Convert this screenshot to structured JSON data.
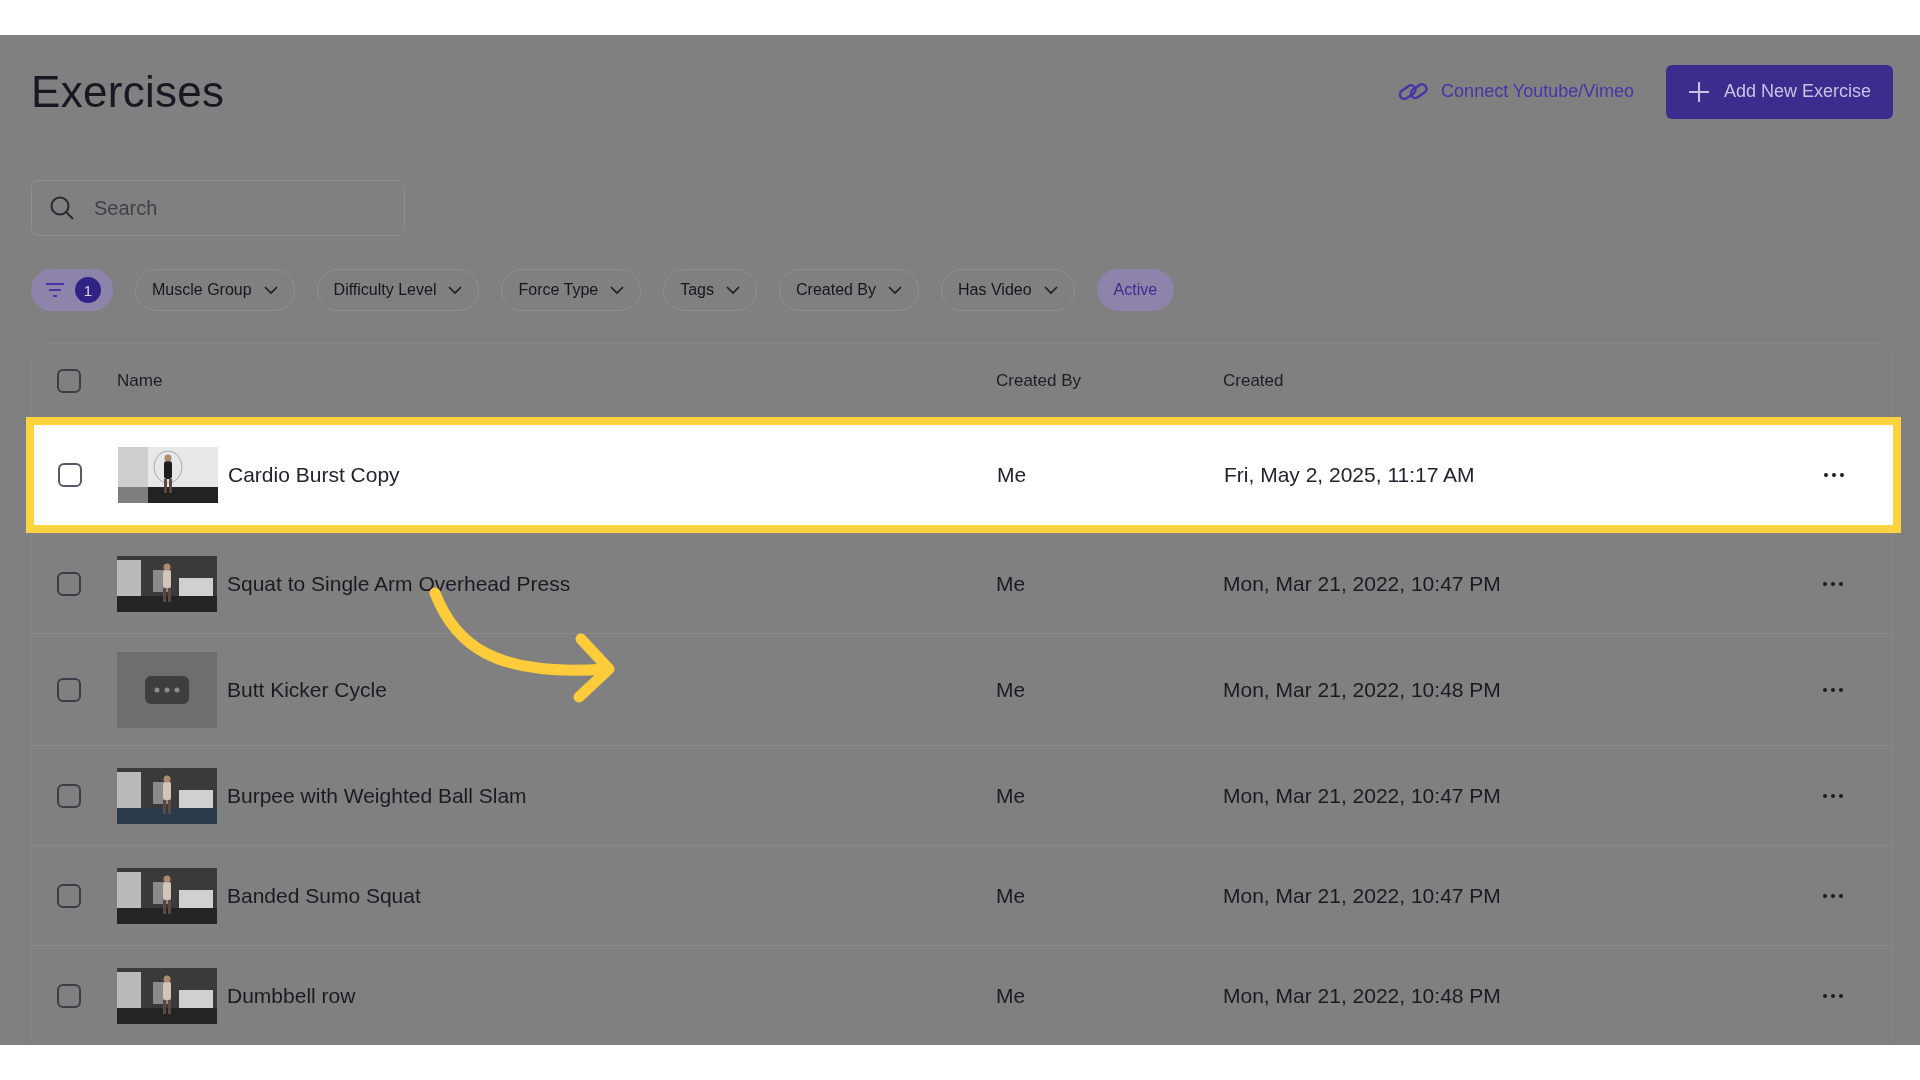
{
  "page": {
    "title": "Exercises"
  },
  "actions": {
    "link": "Connect Youtube/Vimeo",
    "button": "Add New Exercise"
  },
  "search": {
    "placeholder": "Search"
  },
  "filter_count": "1",
  "filters": [
    {
      "label": "Muscle Group",
      "kind": "dropdown",
      "selected": false
    },
    {
      "label": "Difficulty Level",
      "kind": "dropdown",
      "selected": false
    },
    {
      "label": "Force Type",
      "kind": "dropdown",
      "selected": false
    },
    {
      "label": "Tags",
      "kind": "dropdown",
      "selected": false
    },
    {
      "label": "Created By",
      "kind": "dropdown",
      "selected": false
    },
    {
      "label": "Has Video",
      "kind": "dropdown",
      "selected": false
    },
    {
      "label": "Active",
      "kind": "toggle",
      "selected": true
    }
  ],
  "table": {
    "columns": [
      "Name",
      "Created By",
      "Created"
    ],
    "select_all_checked": false,
    "rows": [
      {
        "name": "Cardio Burst Copy",
        "created_by": "Me",
        "created": "Fri, May 2, 2025, 11:17 AM",
        "checked": false,
        "highlighted": true,
        "kind": "picture"
      },
      {
        "name": "Squat to Single Arm Overhead Press",
        "created_by": "Me",
        "created": "Mon, Mar 21, 2022, 10:47 PM",
        "checked": false,
        "highlighted": false,
        "kind": "picture"
      },
      {
        "name": "Butt Kicker Cycle",
        "created_by": "Me",
        "created": "Mon, Mar 21, 2022, 10:48 PM",
        "checked": false,
        "highlighted": false,
        "kind": "placeholder"
      },
      {
        "name": "Burpee with Weighted Ball Slam",
        "created_by": "Me",
        "created": "Mon, Mar 21, 2022, 10:47 PM",
        "checked": false,
        "highlighted": false,
        "kind": "picture"
      },
      {
        "name": "Banded Sumo Squat",
        "created_by": "Me",
        "created": "Mon, Mar 21, 2022, 10:47 PM",
        "checked": false,
        "highlighted": false,
        "kind": "picture"
      },
      {
        "name": "Dumbbell row",
        "created_by": "Me",
        "created": "Mon, Mar 21, 2022, 10:48 PM",
        "checked": false,
        "highlighted": false,
        "kind": "picture"
      }
    ]
  }
}
